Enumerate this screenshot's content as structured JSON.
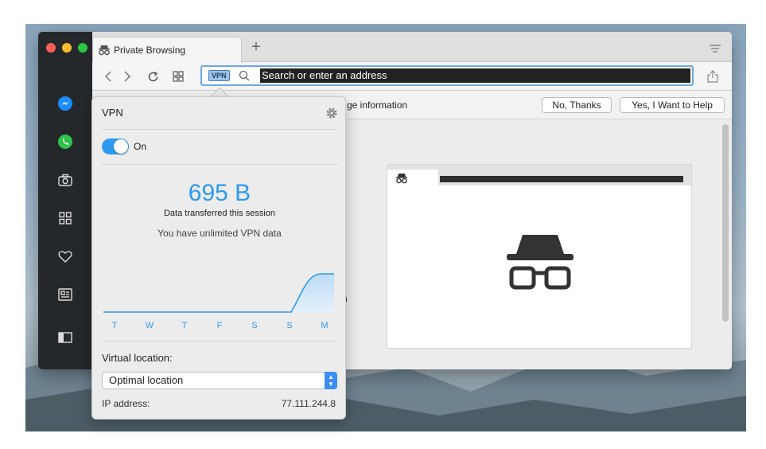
{
  "tab": {
    "title": "Private Browsing"
  },
  "address_bar": {
    "badge": "VPN",
    "placeholder": "Search or enter an address"
  },
  "infobar": {
    "message_fragment": "ge information",
    "no_label": "No, Thanks",
    "yes_label": "Yes, I Want to Help"
  },
  "vpn_popup": {
    "title": "VPN",
    "toggle_label": "On",
    "toggle_on": true,
    "data_amount": "695 B",
    "data_caption": "Data transferred this session",
    "unlimited_text": "You have unlimited VPN data",
    "chart_days": [
      "T",
      "W",
      "T",
      "F",
      "S",
      "S",
      "M"
    ],
    "location_label": "Virtual location:",
    "location_value": "Optimal location",
    "ip_label": "IP address:",
    "ip_value": "77.111.244.8"
  },
  "sidebar_icons": [
    "messenger-icon",
    "whatsapp-icon",
    "camera-icon",
    "grid-icon",
    "heart-icon",
    "news-icon",
    "sidebar-toggle-icon"
  ],
  "colors": {
    "accent": "#2d9af0",
    "sidebar": "#25282b",
    "address_outline": "#6aa8ea"
  }
}
